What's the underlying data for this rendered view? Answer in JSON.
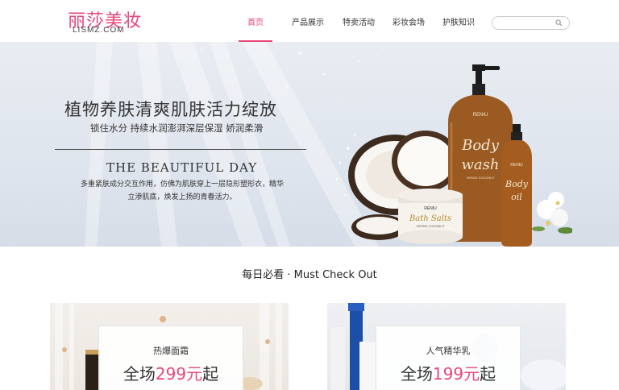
{
  "header": {
    "logo_cn": "丽莎美妆",
    "logo_en": "LISMZ.COM",
    "nav": [
      {
        "label": "首页",
        "active": true
      },
      {
        "label": "产品展示",
        "active": false
      },
      {
        "label": "特卖活动",
        "active": false
      },
      {
        "label": "彩妆会场",
        "active": false
      },
      {
        "label": "护肤知识",
        "active": false
      }
    ],
    "search_placeholder": ""
  },
  "banner": {
    "title": "植物养肤清爽肌肤活力绽放",
    "subtitle": "锁住水分 持续水润澎湃深层保湿 娇润柔滑",
    "english": "THE BEAUTIFUL DAY",
    "desc_line1": "多重紧肤成分交互作用，仿佛为肌肤穿上一层隐形塑形衣，精华",
    "desc_line2": "立渗肌底，焕发上扬的青春活力。",
    "brand": "RENIU",
    "bottle1_line1": "Body",
    "bottle1_line2": "wash",
    "bottle1_small": "VIRGIN COCONUT",
    "jar_line1": "Bath Salts",
    "jar_small": "VIRGIN COCONUT",
    "bottle2_line1": "Body",
    "bottle2_line2": "oil"
  },
  "section": {
    "title": "每日必看 · Must Check Out"
  },
  "cards": [
    {
      "name": "热爆面霜",
      "price_prefix": "全场",
      "price_num": "299元",
      "price_suffix": "起"
    },
    {
      "name": "人气精华乳",
      "price_prefix": "全场",
      "price_num": "199元",
      "price_suffix": "起"
    }
  ],
  "colors": {
    "accent": "#e8477a"
  }
}
